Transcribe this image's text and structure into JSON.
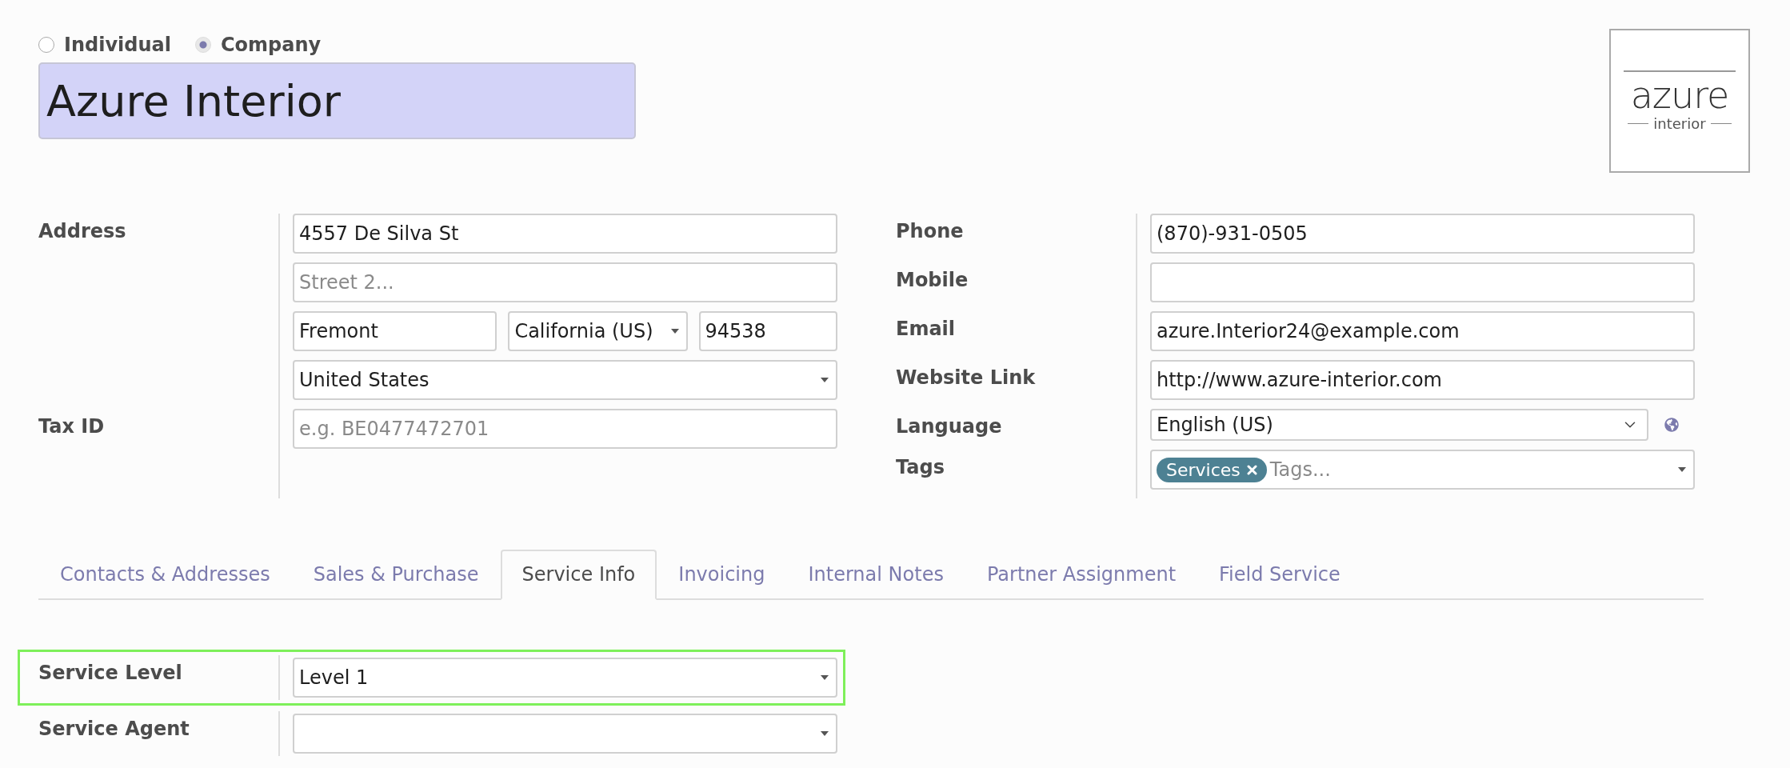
{
  "partner_type": [
    {
      "label": "Individual",
      "selected": false
    },
    {
      "label": "Company",
      "selected": true
    }
  ],
  "name": "Azure Interior",
  "logo": {
    "word": "azure",
    "subword": "interior"
  },
  "left_fields": [
    {
      "label": "Address",
      "rows": [
        [
          {
            "kind": "text",
            "value": "4557 De Silva St"
          }
        ],
        [
          {
            "kind": "text",
            "placeholder": "Street 2..."
          }
        ],
        [
          {
            "kind": "text",
            "value": "Fremont"
          },
          {
            "kind": "select",
            "value": "California (US)"
          },
          {
            "kind": "text",
            "value": "94538"
          }
        ],
        [
          {
            "kind": "select",
            "value": "United States"
          }
        ]
      ]
    },
    {
      "label": "Tax ID",
      "rows": [
        [
          {
            "kind": "text",
            "placeholder": "e.g. BE0477472701"
          }
        ]
      ]
    }
  ],
  "right_fields": [
    {
      "label": "Phone",
      "kind": "text",
      "value": "(870)-931-0505"
    },
    {
      "label": "Mobile",
      "kind": "text"
    },
    {
      "label": "Email",
      "kind": "text",
      "value": "azure.Interior24@example.com"
    },
    {
      "label": "Website Link",
      "kind": "text",
      "value": "http://www.azure-interior.com"
    },
    {
      "label": "Language",
      "kind": "language",
      "value": "English (US)"
    },
    {
      "label": "Tags",
      "kind": "tags",
      "tags": [
        {
          "label": "Services"
        }
      ],
      "placeholder": "Tags..."
    }
  ],
  "tabs": [
    {
      "label": "Contacts & Addresses",
      "selected": false
    },
    {
      "label": "Sales & Purchase",
      "selected": false
    },
    {
      "label": "Service Info",
      "selected": true
    },
    {
      "label": "Invoicing",
      "selected": false
    },
    {
      "label": "Internal Notes",
      "selected": false
    },
    {
      "label": "Partner Assignment",
      "selected": false
    },
    {
      "label": "Field Service",
      "selected": false
    }
  ],
  "service_fields": [
    {
      "label": "Service Level",
      "kind": "select",
      "value": "Level 1",
      "highlighted": true
    },
    {
      "label": "Service Agent",
      "kind": "select",
      "highlighted": false
    }
  ]
}
